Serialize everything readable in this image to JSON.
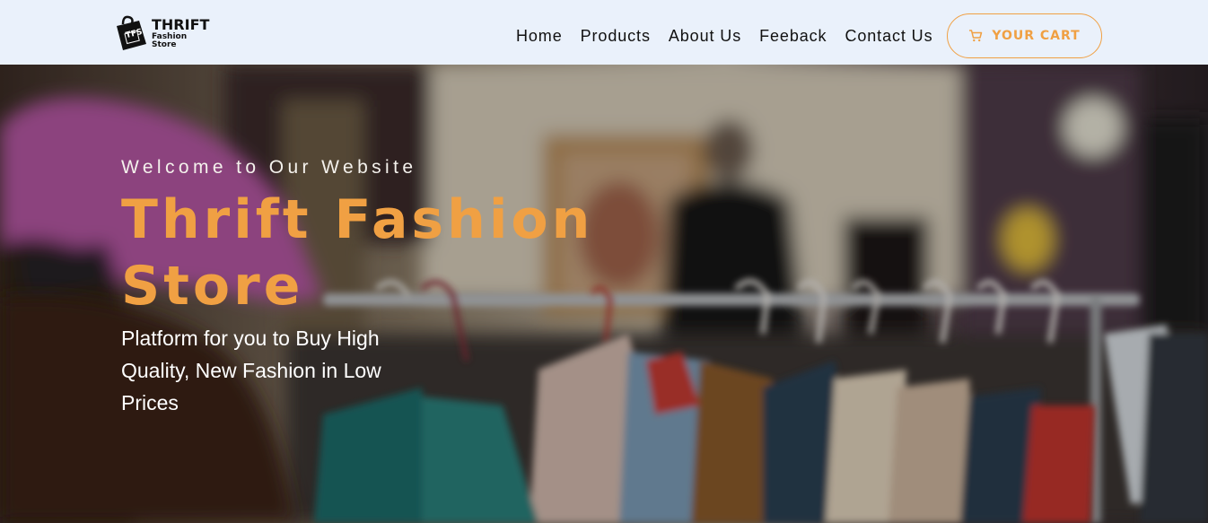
{
  "brand": {
    "logo_mark_text": "TFS",
    "title": "THRIFT",
    "subtitle": "Fashion Store"
  },
  "nav": {
    "items": [
      "Home",
      "Products",
      "About Us",
      "Feeback",
      "Contact Us"
    ]
  },
  "cart": {
    "label": "YOUR CART",
    "icon": "shopping-cart-icon"
  },
  "hero": {
    "welcome": "Welcome to Our Website",
    "title": "Thrift Fashion Store",
    "subtitle": "Platform for you to Buy High Quality, New Fashion in Low Prices",
    "background": "blurred-thrift-clothing-rack-photo"
  },
  "colors": {
    "accent": "#f0a043",
    "header_bg": "#eaf1fb",
    "text_dark": "#111111"
  }
}
